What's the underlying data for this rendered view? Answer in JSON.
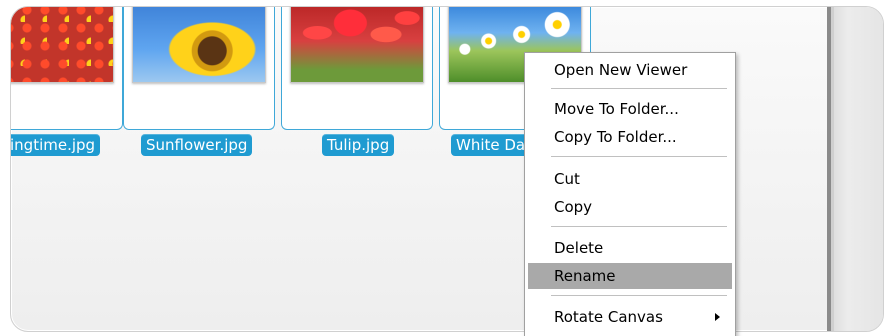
{
  "thumbnails": [
    {
      "name": "Springtime.jpg",
      "label": "ingtime.jpg"
    },
    {
      "name": "Sunflower.jpg",
      "label": "Sunflower.jpg"
    },
    {
      "name": "Tulip.jpg",
      "label": "Tulip.jpg"
    },
    {
      "name": "White Daisies.jpg",
      "label": "White Da"
    }
  ],
  "context_menu": {
    "items": [
      {
        "label": "Open New Viewer"
      },
      {
        "label": "Move To Folder..."
      },
      {
        "label": "Copy To Folder..."
      },
      {
        "label": "Cut"
      },
      {
        "label": "Copy"
      },
      {
        "label": "Delete"
      },
      {
        "label": "Rename",
        "highlighted": true
      },
      {
        "label": "Rotate Canvas",
        "has_submenu": true
      }
    ]
  },
  "colors": {
    "label_bg": "#1f9bd1",
    "selection_border": "#3fa8d8",
    "menu_highlight": "#a9a9a9"
  }
}
